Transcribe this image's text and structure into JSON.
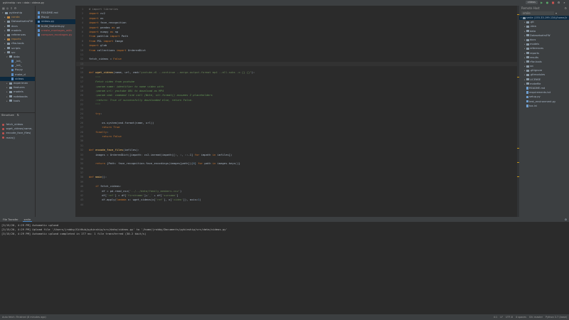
{
  "titlebar": {
    "crumbs": [
      "pykinship",
      "src",
      "data",
      "videos.py"
    ],
    "run_config": "videos"
  },
  "left_tree": {
    "root": "pykinship",
    "items": [
      {
        "label": "pykinship",
        "indent": 1,
        "kind": "folder",
        "open": true
      },
      {
        "label": "conda",
        "indent": 2,
        "kind": "folder-orange"
      },
      {
        "label": "DatasetsetrsFW",
        "indent": 2,
        "kind": "folder"
      },
      {
        "label": "docs",
        "indent": 2,
        "kind": "folder"
      },
      {
        "label": "models",
        "indent": 2,
        "kind": "folder"
      },
      {
        "label": "references",
        "indent": 2,
        "kind": "folder"
      },
      {
        "label": "reports",
        "indent": 2,
        "kind": "folder-orange"
      },
      {
        "label": "rfiw-tools",
        "indent": 2,
        "kind": "folder"
      },
      {
        "label": "scripts",
        "indent": 2,
        "kind": "folder"
      },
      {
        "label": "src",
        "indent": 2,
        "kind": "folder",
        "open": true
      },
      {
        "label": "data",
        "indent": 3,
        "kind": "folder",
        "open": true
      },
      {
        "label": "_init_",
        "indent": 4,
        "kind": "file"
      },
      {
        "label": "_init_",
        "indent": 4,
        "kind": "file"
      },
      {
        "label": "fiw.py",
        "indent": 4,
        "kind": "file"
      },
      {
        "label": "make_d",
        "indent": 4,
        "kind": "file"
      },
      {
        "label": "videos",
        "indent": 4,
        "kind": "file",
        "selected": true
      },
      {
        "label": "experimen",
        "indent": 3,
        "kind": "folder"
      },
      {
        "label": "features",
        "indent": 3,
        "kind": "folder"
      },
      {
        "label": "models",
        "indent": 3,
        "kind": "folder"
      },
      {
        "label": "notebooks",
        "indent": 3,
        "kind": "folder"
      },
      {
        "label": "tools",
        "indent": 3,
        "kind": "folder"
      }
    ]
  },
  "structure": {
    "title": "Structure",
    "items": [
      "fetch_videos",
      "wget_videos(name,",
      "encode_face_files(",
      "main()"
    ]
  },
  "open_files": {
    "items": [
      {
        "label": "README.md",
        "color": "#a9b7c6"
      },
      {
        "label": "fiw.py",
        "color": "#a9b7c6"
      },
      {
        "label": "videos.py",
        "color": "#a9b7c6",
        "selected": true
      },
      {
        "label": "build_features.py",
        "color": "#a9b7c6"
      },
      {
        "label": "create_montages_with",
        "color": "#c75450"
      },
      {
        "label": "compare_montages.py",
        "color": "#c75450"
      }
    ]
  },
  "editor": {
    "lines": [
      {
        "n": "1",
        "html": "<span class='cm'># import libraries</span>"
      },
      {
        "n": "2",
        "html": "<span class='kw'>import</span> cv2"
      },
      {
        "n": "3",
        "html": "<span class='kw'>import</span> os"
      },
      {
        "n": "4",
        "html": "<span class='kw'>import</span> face_recognition"
      },
      {
        "n": "5",
        "html": "<span class='kw'>import</span> pandas <span class='kw'>as</span> pd"
      },
      {
        "n": "6",
        "html": "<span class='kw'>import</span> numpy <span class='kw'>as</span> np"
      },
      {
        "n": "7",
        "html": "<span class='kw'>from</span> pathlib <span class='kw'>import</span> Path"
      },
      {
        "n": "8",
        "html": "<span class='kw'>from</span> PIL <span class='kw'>import</span> Image"
      },
      {
        "n": "9",
        "html": "<span class='kw'>import</span> glob"
      },
      {
        "n": "10",
        "html": "<span class='kw'>from</span> collections <span class='kw'>import</span> OrderedDict"
      },
      {
        "n": "11",
        "html": ""
      },
      {
        "n": "12",
        "html": "fetch_videos = <span class='kw'>False</span>"
      },
      {
        "n": "13",
        "html": "",
        "cur": true
      },
      {
        "n": "14",
        "html": ""
      },
      {
        "n": "15",
        "html": "<span class='kw'>def</span> <span class='fn'>wget_videos</span>(name, url, cmd=<span class='str'>\"youtube-dl --continue --merge-output-format mp4 --all-subs -o {} {}\"</span>):"
      },
      {
        "n": "16",
        "html": "    <span class='doc'>\"\"\"</span>"
      },
      {
        "n": "17",
        "html": "    <span class='doc'>Fetch video from youtube</span>"
      },
      {
        "n": "18",
        "html": "    <span class='doc'>:param name: identifier to name video with</span>"
      },
      {
        "n": "19",
        "html": "    <span class='doc'>:param url: youtube URL to download as MP4</span>"
      },
      {
        "n": "20",
        "html": "    <span class='doc'>:param cmd: command line call (Note, str.format() assumes 2 placeholders</span>"
      },
      {
        "n": "21",
        "html": "    <span class='doc'>:return: True if successfully downloaded else, return False.</span>"
      },
      {
        "n": "22",
        "html": "    <span class='doc'>\"\"\"</span>"
      },
      {
        "n": "23",
        "html": ""
      },
      {
        "n": "24",
        "html": "    <span class='kw'>try</span>:"
      },
      {
        "n": "25",
        "html": ""
      },
      {
        "n": "26",
        "html": "        os.system(cmd.format(name, url))"
      },
      {
        "n": "27",
        "html": "        <span class='kw'>return</span> <span class='kw'>True</span>"
      },
      {
        "n": "28",
        "html": "    <span class='kw'>finally</span>:"
      },
      {
        "n": "29",
        "html": "        <span class='kw'>return</span> <span class='kw'>False</span>"
      },
      {
        "n": "30",
        "html": ""
      },
      {
        "n": "31",
        "html": ""
      },
      {
        "n": "32",
        "html": "<span class='kw'>def</span> <span class='fn'>encode_face_files</span>(imfiles):"
      },
      {
        "n": "33",
        "html": "    images = OrderedDict({impath: cv2.imread(impath)[:, :, ::-1] <span class='kw'>for</span> impath <span class='kw'>in</span> imfiles})"
      },
      {
        "n": "34",
        "html": ""
      },
      {
        "n": "35",
        "html": "    <span class='kw'>return</span> {Path: face_recognition.face_encodings(images[path])[<span class='num'>0</span>] <span class='kw'>for</span> path <span class='kw'>in</span> images.keys()}"
      },
      {
        "n": "36",
        "html": ""
      },
      {
        "n": "37",
        "html": ""
      },
      {
        "n": "38",
        "html": "<span class='kw'>def</span> <span class='fn'>main</span>():"
      },
      {
        "n": "39",
        "html": ""
      },
      {
        "n": "40",
        "html": "    <span class='kw'>if</span> fetch_videos:"
      },
      {
        "n": "41",
        "html": "        df = pd.read_csv(<span class='str'>'../../data/family_members.csv'</span>)"
      },
      {
        "n": "42",
        "html": "        df[<span class='str'>'ref'</span>] = df[<span class='str'>'firstname'</span>]+<span class='str'>'_'</span> + df[<span class='str'>'surname'</span>]"
      },
      {
        "n": "43",
        "html": "        df.apply(<span class='kw'>lambda</span> x: wget_videos(x[<span class='str'>'ref'</span>], x[<span class='str'>'video'</span>]), axis=<span class='num'>1</span>)"
      },
      {
        "n": "44",
        "html": ""
      }
    ]
  },
  "remote": {
    "title": "Remote Host",
    "host": "smile",
    "root": "smile (155.33.199.134)/home/jr",
    "items": [
      ".git",
      ".idea",
      "data",
      "DatasetsetrsFW",
      "docs",
      "models",
      "references",
      "reports",
      "results",
      "rfiw-tools",
      "src",
      ".gitignore",
      ".gitmodules",
      "LICENSE",
      "makefile",
      "README.md",
      "requirements.txt",
      "setup.py",
      "test_environment.py",
      "tox.ini"
    ]
  },
  "bottom": {
    "tabs": [
      "File Transfer",
      "smile"
    ],
    "logs": [
      "[3/15/20, 4:29 PM] Automatic upload",
      "[3/15/20, 4:29 PM] Upload file '/Users/jrobby/GitHub/pykinship/src/data/videos.py' to '/home/jrobby/Documents/pykinship/src/data/videos.py'",
      "[3/15/20, 4:29 PM] Automatic upload completed in 177 ms: 1 file transferred (30.2 kbit/s)"
    ]
  },
  "status": {
    "left": "Auto fetch: Finished (8 minutes ago)",
    "right": [
      "4:1",
      "LF",
      "UTF-8",
      "4 spaces",
      "Git: master",
      "Python 3.7 (base)"
    ]
  }
}
